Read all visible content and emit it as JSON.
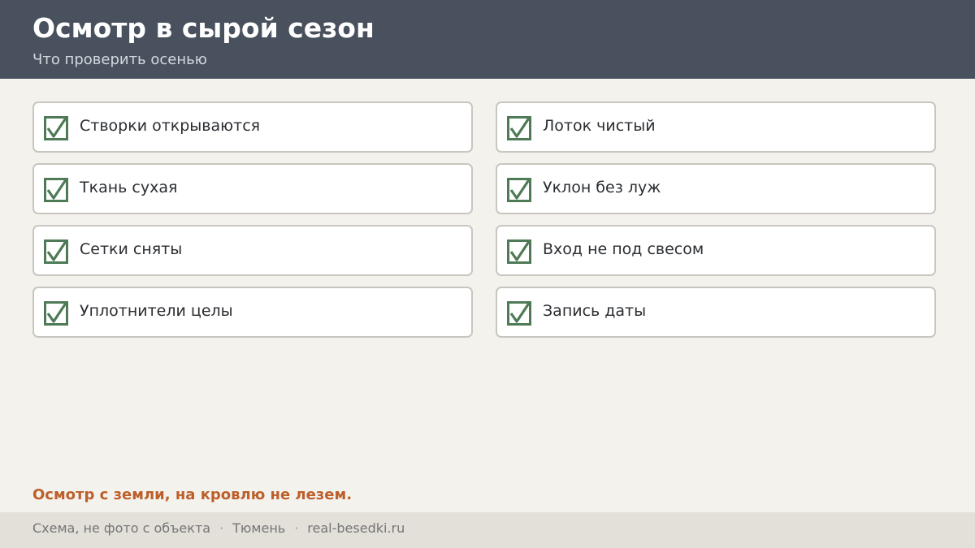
{
  "header": {
    "title": "Осмотр в сырой сезон",
    "subtitle": "Что проверить осенью"
  },
  "checklist": {
    "left": [
      {
        "label": "Створки открываются",
        "checked": true
      },
      {
        "label": "Ткань сухая",
        "checked": true
      },
      {
        "label": "Сетки сняты",
        "checked": true
      },
      {
        "label": "Уплотнители целы",
        "checked": true
      }
    ],
    "right": [
      {
        "label": "Лоток чистый",
        "checked": true
      },
      {
        "label": "Уклон без луж",
        "checked": true
      },
      {
        "label": "Вход не под свесом",
        "checked": true
      },
      {
        "label": "Запись даты",
        "checked": true
      }
    ],
    "icon": "checkbox-checked-icon"
  },
  "note": "Осмотр с земли, на кровлю не лезем.",
  "footer": {
    "caption": "Схема, не фото с объекта",
    "separator": "·",
    "city": "Тюмень",
    "site": "real-besedki.ru"
  },
  "colors": {
    "header_bg": "#48515d",
    "page_bg": "#f4f2ed",
    "check_green": "#4e7a56",
    "accent_orange": "#bd5f2b",
    "footer_bg": "#e3e0da"
  }
}
